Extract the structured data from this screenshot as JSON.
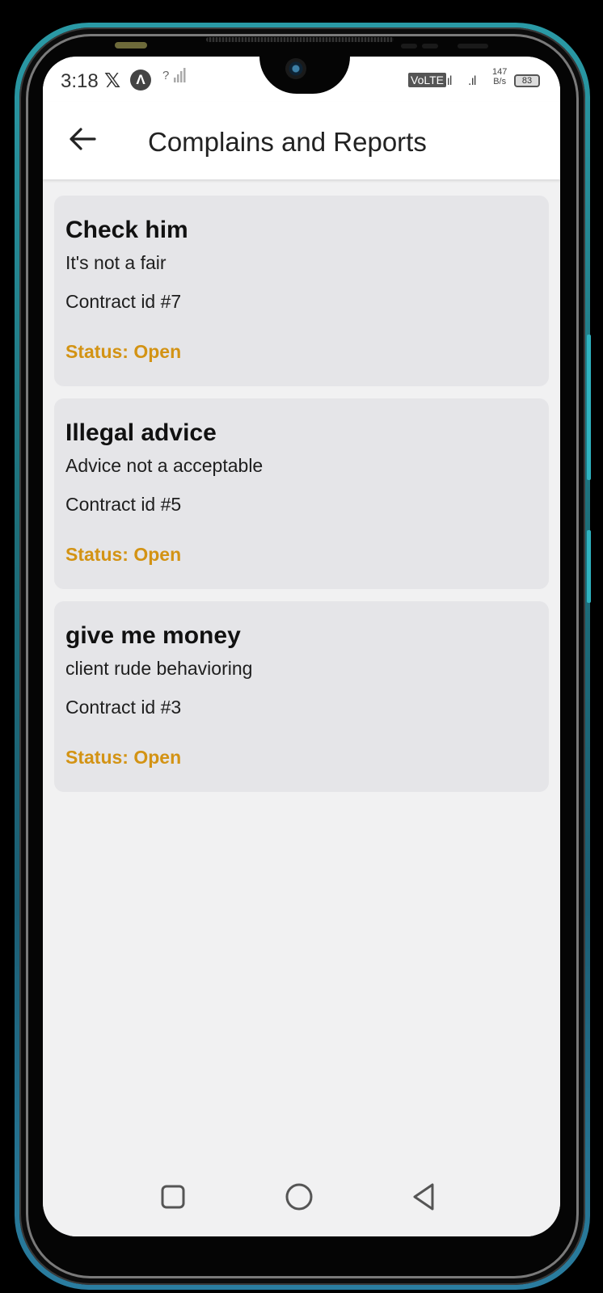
{
  "statusbar": {
    "time": "3:18",
    "x_app": "𝕏",
    "a_app": "Λ",
    "sim_question": "?",
    "volte": "VoLTE",
    "signal_1": ".ıl",
    "signal_2": ".ıl",
    "rate_value": "147",
    "rate_unit": "B/s",
    "battery": "83"
  },
  "appbar": {
    "title": "Complains and Reports"
  },
  "complaints": [
    {
      "title": "Check him",
      "description": "It's not a fair",
      "contract": "Contract id #7",
      "status": "Status: Open"
    },
    {
      "title": "Illegal advice",
      "description": "Advice not a acceptable",
      "contract": "Contract id #5",
      "status": "Status: Open"
    },
    {
      "title": "give me money",
      "description": "client rude behavioring",
      "contract": "Contract id #3",
      "status": "Status: Open"
    }
  ],
  "colors": {
    "status_open": "#d39314",
    "card_bg": "#e5e5e8",
    "frame_accent": "#2a9aa6"
  },
  "icons": {
    "back": "arrow-left-icon",
    "recents": "square-icon",
    "home": "circle-icon",
    "back_nav": "triangle-back-icon"
  }
}
